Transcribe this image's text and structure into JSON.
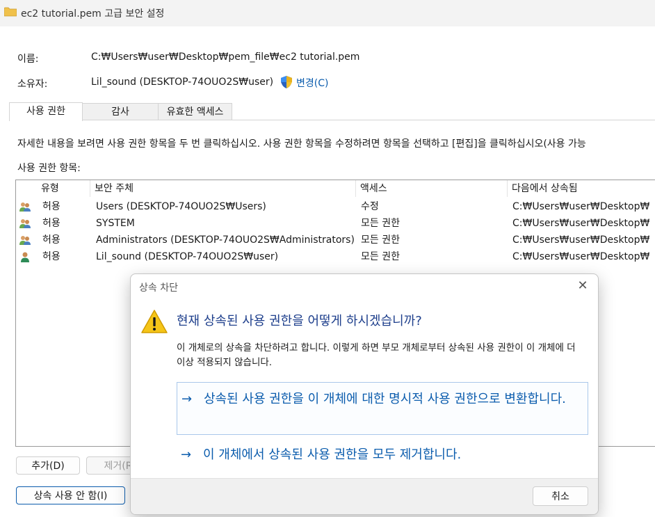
{
  "window": {
    "title": "ec2 tutorial.pem 고급 보안 설정"
  },
  "name": {
    "label": "이름:",
    "value": "C:₩Users₩user₩Desktop₩pem_file₩ec2 tutorial.pem"
  },
  "owner": {
    "label": "소유자:",
    "value": "Lil_sound (DESKTOP-74OUO2S₩user)",
    "change_label": "변경(C)"
  },
  "tabs": [
    {
      "label": "사용 권한"
    },
    {
      "label": "감사"
    },
    {
      "label": "유효한 액세스"
    }
  ],
  "instructions": "자세한 내용을 보려면 사용 권한 항목을 두 번 클릭하십시오. 사용 권한 항목을 수정하려면 항목을 선택하고 [편집]을 클릭하십시오(사용 가능",
  "entries_label": "사용 권한 항목:",
  "table": {
    "headers": [
      "유형",
      "보안 주체",
      "액세스",
      "다음에서 상속됨"
    ],
    "rows": [
      {
        "icon": "group-user-icon",
        "type": "허용",
        "principal": "Users (DESKTOP-74OUO2S₩Users)",
        "access": "수정",
        "inherited": "C:₩Users₩user₩Desktop₩"
      },
      {
        "icon": "group-user-icon",
        "type": "허용",
        "principal": "SYSTEM",
        "access": "모든 권한",
        "inherited": "C:₩Users₩user₩Desktop₩"
      },
      {
        "icon": "group-user-icon",
        "type": "허용",
        "principal": "Administrators (DESKTOP-74OUO2S₩Administrators)",
        "access": "모든 권한",
        "inherited": "C:₩Users₩user₩Desktop₩"
      },
      {
        "icon": "single-user-icon",
        "type": "허용",
        "principal": "Lil_sound (DESKTOP-74OUO2S₩user)",
        "access": "모든 권한",
        "inherited": "C:₩Users₩user₩Desktop₩"
      }
    ]
  },
  "buttons": {
    "add": "추가(D)",
    "remove": "제거(R",
    "disable_inheritance": "상속 사용 안 함(I)"
  },
  "dialog": {
    "title": "상속 차단",
    "heading": "현재 상속된 사용 권한을 어떻게 하시겠습니까?",
    "body": "이 개체로의 상속을 차단하려고 합니다. 이렇게 하면 부모 개체로부터 상속된 사용 권한이 이 개체에 더 이상 적용되지 않습니다.",
    "option_convert": "상속된 사용 권한을 이 개체에 대한 명시적 사용 권한으로 변환합니다.",
    "option_remove": "이 개체에서 상속된 사용 권한을 모두 제거합니다.",
    "arrow": "→",
    "cancel": "취소",
    "close": "✕"
  },
  "colors": {
    "link": "#0b5cad",
    "heading": "#1e3f8c",
    "warning": "#f5c518"
  }
}
